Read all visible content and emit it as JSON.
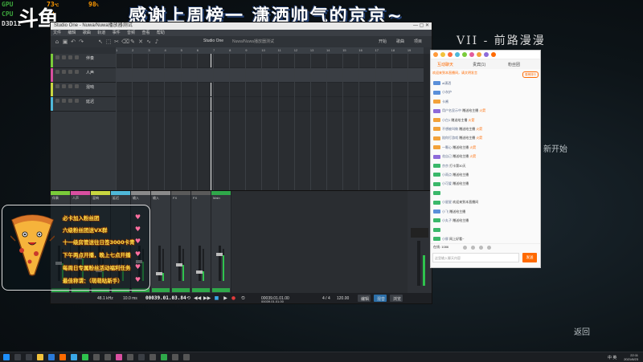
{
  "hud": {
    "rows": [
      {
        "label": "GPU",
        "v1": "73",
        "u1": "℃",
        "v2": "98",
        "u2": "%"
      },
      {
        "label": "CPU",
        "v1": "20",
        "u1": "%"
      },
      {
        "label": "D3D11",
        "v1": "9"
      }
    ],
    "colors": {
      "label": "#3ba33b",
      "value": "#ff9900"
    }
  },
  "logo": "斗鱼",
  "banner": "感谢上周榜一 潇洒帅气的京京~",
  "song_title": "VII - 前路漫漫",
  "lyrics": [
    "新开始",
    "返回"
  ],
  "daw": {
    "title": "Studio One - Nuwa/Nuwa播放器测试",
    "window_controls": "— ▢ ✕",
    "menu": [
      "文件",
      "编辑",
      "歌曲",
      "轨道",
      "事件",
      "音频",
      "查看",
      "帮助"
    ],
    "toolbar_labels": {
      "song_center": "Studio One",
      "song_name": "Nuwa/Nuwa播放器测试",
      "start": "开始",
      "song": "歌曲",
      "project": "项目"
    },
    "ruler": [
      "1",
      "2",
      "3",
      "4",
      "5",
      "6",
      "7",
      "8",
      "9",
      "10",
      "11",
      "12",
      "13",
      "14",
      "15",
      "16",
      "17",
      "18",
      "19"
    ],
    "tracks": [
      {
        "name": "伴奏",
        "color": "#7acb3a"
      },
      {
        "name": "人声",
        "color": "#d94fa0"
      },
      {
        "name": "混响",
        "color": "#c8d640"
      },
      {
        "name": "延迟",
        "color": "#4fb8d9"
      }
    ],
    "mixer": {
      "strips": [
        {
          "label": "伴奏",
          "color": "#7acb3a",
          "level": 0.55
        },
        {
          "label": "人声",
          "color": "#d94fa0",
          "level": 0.7
        },
        {
          "label": "混响",
          "color": "#c8d640",
          "level": 0.35
        },
        {
          "label": "延迟",
          "color": "#4fb8d9",
          "level": 0.45
        },
        {
          "label": "输入",
          "color": "#8a8a8a",
          "level": 0.6
        },
        {
          "label": "输入",
          "color": "#8a8a8a",
          "level": 0.25
        },
        {
          "label": "FX",
          "color": "#5a5a5a",
          "level": 0.5
        },
        {
          "label": "FX",
          "color": "#5a5a5a",
          "level": 0.3
        },
        {
          "label": "Main",
          "color": "#2fa84a",
          "level": 0.8
        }
      ]
    },
    "transport": {
      "sample_rate": "48.1 kHz",
      "latency": "10.0 ms",
      "timecode": "00039.01.03.84",
      "position_left": "00039.01.01.00",
      "position_right": "00039.01.01.00",
      "meter": "4 / 4",
      "tempo": "120.00",
      "edit": "编辑",
      "mix": "混音",
      "browse": "浏览"
    }
  },
  "chat": {
    "tabs": [
      "互动聊天",
      "贵宾(1)",
      "粉丝团"
    ],
    "active_tab": 0,
    "notice": "欢迎来到本直播间，请文明发言",
    "rank_button": "周榜排行",
    "messages": [
      {
        "level_color": "#5a8fd9",
        "user": "ai潇洒",
        "text": ""
      },
      {
        "level_color": "#5a8fd9",
        "user": "小灰护",
        "text": ""
      },
      {
        "level_color": "#f2a23a",
        "user": "卡酱",
        "text": ""
      },
      {
        "level_color": "#8d6ad9",
        "user": "用户名显示中 ",
        "text": "赠送给主播",
        "gift": "火箭"
      },
      {
        "level_color": "#f2a23a",
        "user": "小白1",
        "text": "赠送给主播",
        "gift": "火箭"
      },
      {
        "level_color": "#f2a23a",
        "user": "不想被叫做",
        "text": "赠送给主播",
        "gift": "火箭"
      },
      {
        "level_color": "#f2a23a",
        "user": "陪你打游戏",
        "text": "赠送给主播",
        "gift": "火箭"
      },
      {
        "level_color": "#f2a23a",
        "user": "一颗心",
        "text": "赠送给主播",
        "gift": "火箭"
      },
      {
        "level_color": "#8d6ad9",
        "user": "花自己",
        "text": "赠送给主播",
        "gift": "火箭"
      },
      {
        "level_color": "#3ab86a",
        "user": "京京",
        "text": "打卡第30天",
        "gift": ""
      },
      {
        "level_color": "#3ab86a",
        "user": "小雨点",
        "text": "赠送给主播",
        "gift": ""
      },
      {
        "level_color": "#3ab86a",
        "user": "小可爱",
        "text": "赠送给主播",
        "gift": ""
      },
      {
        "level_color": "#3ab86a",
        "user": "",
        "text": "",
        "gift": ""
      },
      {
        "level_color": "#3ab86a",
        "user": "小星星",
        "text": "欢迎来到本直播间",
        "gift": ""
      },
      {
        "level_color": "#5a8fd9",
        "user": "小飞",
        "text": "赠送给主播",
        "gift": ""
      },
      {
        "level_color": "#3ab86a",
        "user": "小丸子",
        "text": "赠送给主播",
        "gift": ""
      },
      {
        "level_color": "#3ab86a",
        "user": "",
        "text": "",
        "gift": ""
      },
      {
        "level_color": "#3ab86a",
        "user": "小胖",
        "text": "网上好看~",
        "gift": ""
      }
    ],
    "viewer_count": "在线: 1086",
    "input_placeholder": "这里输入聊天内容",
    "send_button": "发送"
  },
  "announce": {
    "lines": [
      "必卡加入粉丝团",
      "六级粉丝团送VX群",
      "十一级房管送往日签3000卡青",
      "下午两点开播，晚上七点开播",
      "每周日专属粉丝活动福利任务",
      "最佳称谓：（萌萌哒新手）"
    ]
  },
  "taskbar": {
    "ime": "中 英",
    "time": "22:11",
    "date": "2021/8/23"
  }
}
